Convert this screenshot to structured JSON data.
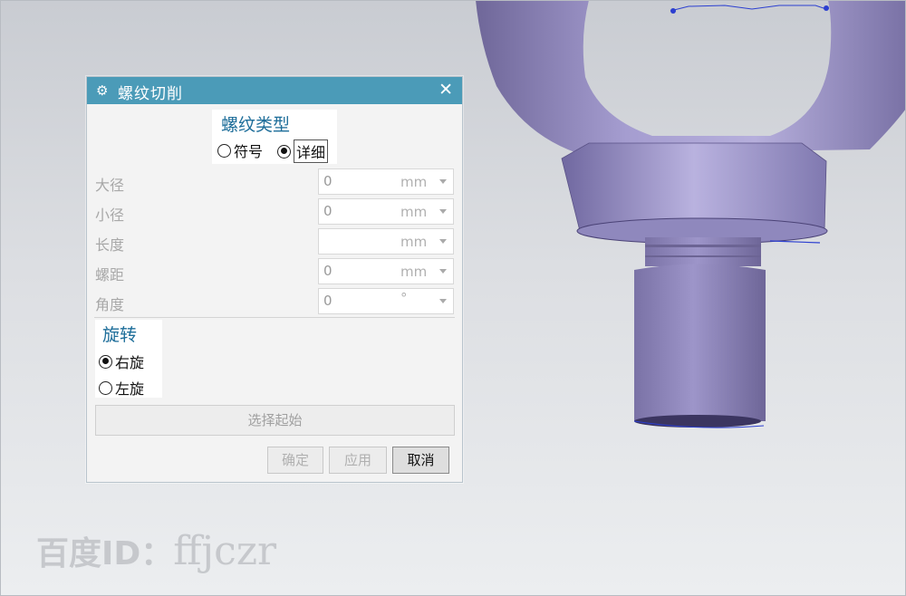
{
  "dialog": {
    "title": "螺纹切削",
    "close_glyph": "✕",
    "gear_glyph": "⚙",
    "thread_type": {
      "label": "螺纹类型",
      "options": [
        {
          "label": "符号",
          "checked": false
        },
        {
          "label": "详细",
          "checked": true
        }
      ]
    },
    "fields": [
      {
        "label": "大径",
        "value": "0",
        "unit": "mm"
      },
      {
        "label": "小径",
        "value": "0",
        "unit": "mm"
      },
      {
        "label": "长度",
        "value": "",
        "unit": "mm"
      },
      {
        "label": "螺距",
        "value": "0",
        "unit": "mm"
      },
      {
        "label": "角度",
        "value": "0",
        "unit": "°"
      }
    ],
    "rotation": {
      "label": "旋转",
      "options": [
        {
          "label": "右旋",
          "checked": true
        },
        {
          "label": "左旋",
          "checked": false
        }
      ]
    },
    "select_start": "选择起始",
    "buttons": {
      "ok": "确定",
      "apply": "应用",
      "cancel": "取消"
    }
  },
  "watermark": {
    "prefix": "百度ID：",
    "id": "ffjczr"
  },
  "colors": {
    "title_bar": "#4b9bb8",
    "group_label": "#1e6e9a",
    "model_purple": "#9a92c8"
  }
}
